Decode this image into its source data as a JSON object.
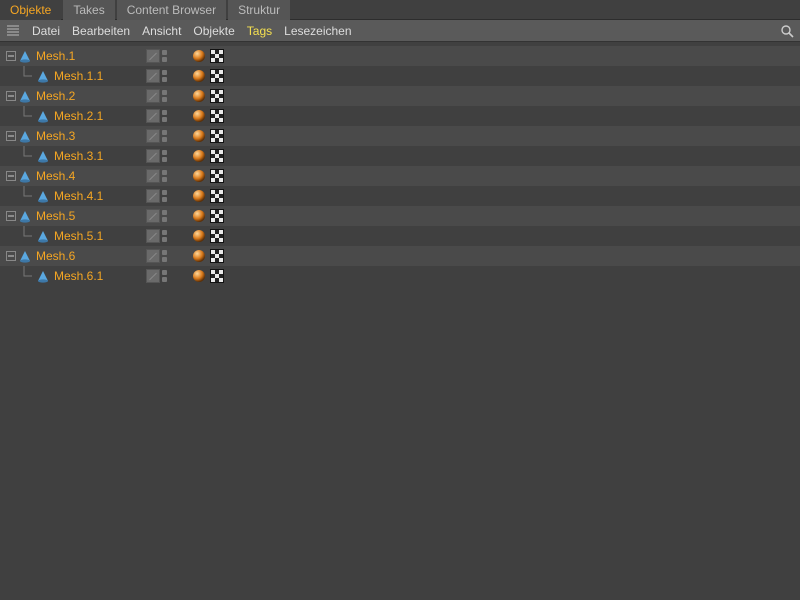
{
  "tabs": [
    {
      "label": "Objekte",
      "active": true
    },
    {
      "label": "Takes",
      "active": false
    },
    {
      "label": "Content Browser",
      "active": false
    },
    {
      "label": "Struktur",
      "active": false
    }
  ],
  "menu": {
    "items": [
      {
        "label": "Datei",
        "active": false
      },
      {
        "label": "Bearbeiten",
        "active": false
      },
      {
        "label": "Ansicht",
        "active": false
      },
      {
        "label": "Objekte",
        "active": false
      },
      {
        "label": "Tags",
        "active": true
      },
      {
        "label": "Lesezeichen",
        "active": false
      }
    ]
  },
  "objects": [
    {
      "name": "Mesh.1",
      "children": [
        {
          "name": "Mesh.1.1"
        }
      ]
    },
    {
      "name": "Mesh.2",
      "children": [
        {
          "name": "Mesh.2.1"
        }
      ]
    },
    {
      "name": "Mesh.3",
      "children": [
        {
          "name": "Mesh.3.1"
        }
      ]
    },
    {
      "name": "Mesh.4",
      "children": [
        {
          "name": "Mesh.4.1"
        }
      ]
    },
    {
      "name": "Mesh.5",
      "children": [
        {
          "name": "Mesh.5.1"
        }
      ]
    },
    {
      "name": "Mesh.6",
      "children": [
        {
          "name": "Mesh.6.1"
        }
      ]
    }
  ],
  "iconNames": {
    "phong": "phong-tag-icon",
    "uv": "uvw-tag-icon"
  }
}
